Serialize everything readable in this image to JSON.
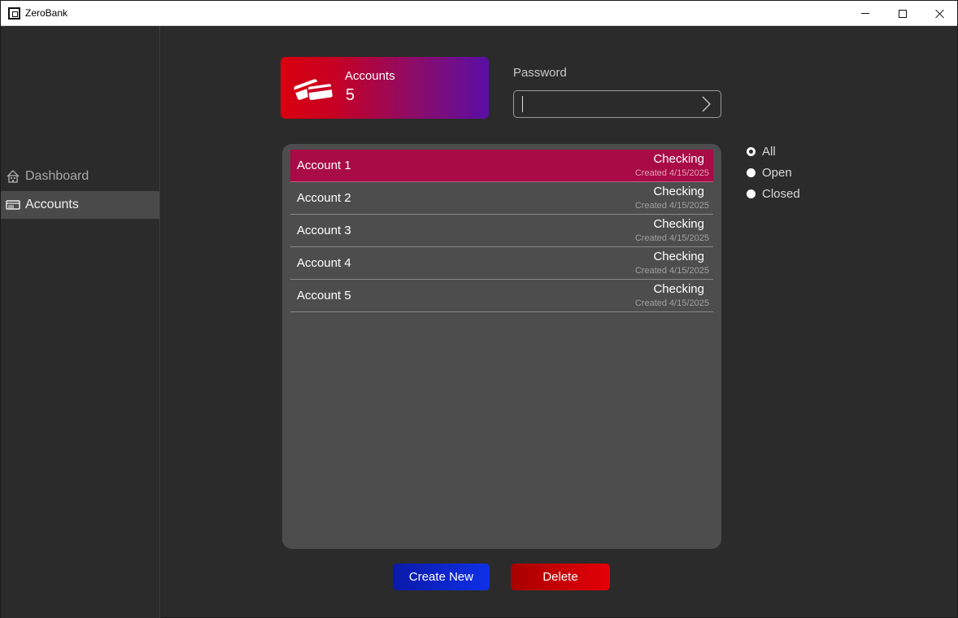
{
  "window": {
    "title": "ZeroBank",
    "controls": {
      "minimize": "minimize-icon",
      "maximize": "maximize-icon",
      "close": "close-icon"
    }
  },
  "sidebar": {
    "items": [
      {
        "label": "Dashboard",
        "icon": "home-icon",
        "selected": false
      },
      {
        "label": "Accounts",
        "icon": "card-icon",
        "selected": true
      }
    ]
  },
  "summary_card": {
    "label": "Accounts",
    "count": "5",
    "icon": "credit-cards-icon",
    "gradient": [
      "#d8000e",
      "#5a0fa6"
    ]
  },
  "password": {
    "label": "Password",
    "value": "",
    "submit_icon": "chevron-right-icon"
  },
  "accounts": [
    {
      "name": "Account 1",
      "type": "Checking",
      "created": "Created 4/15/2025",
      "selected": true
    },
    {
      "name": "Account 2",
      "type": "Checking",
      "created": "Created 4/15/2025",
      "selected": false
    },
    {
      "name": "Account 3",
      "type": "Checking",
      "created": "Created 4/15/2025",
      "selected": false
    },
    {
      "name": "Account 4",
      "type": "Checking",
      "created": "Created 4/15/2025",
      "selected": false
    },
    {
      "name": "Account 5",
      "type": "Checking",
      "created": "Created 4/15/2025",
      "selected": false
    }
  ],
  "filters": {
    "options": [
      "All",
      "Open",
      "Closed"
    ],
    "selected": "All"
  },
  "actions": {
    "create_label": "Create New",
    "delete_label": "Delete"
  },
  "colors": {
    "background": "#2b2b2b",
    "panel": "#4d4d4d",
    "selected_row": "#a80b45",
    "create_button": "#0f30e6",
    "delete_button": "#e50008"
  }
}
